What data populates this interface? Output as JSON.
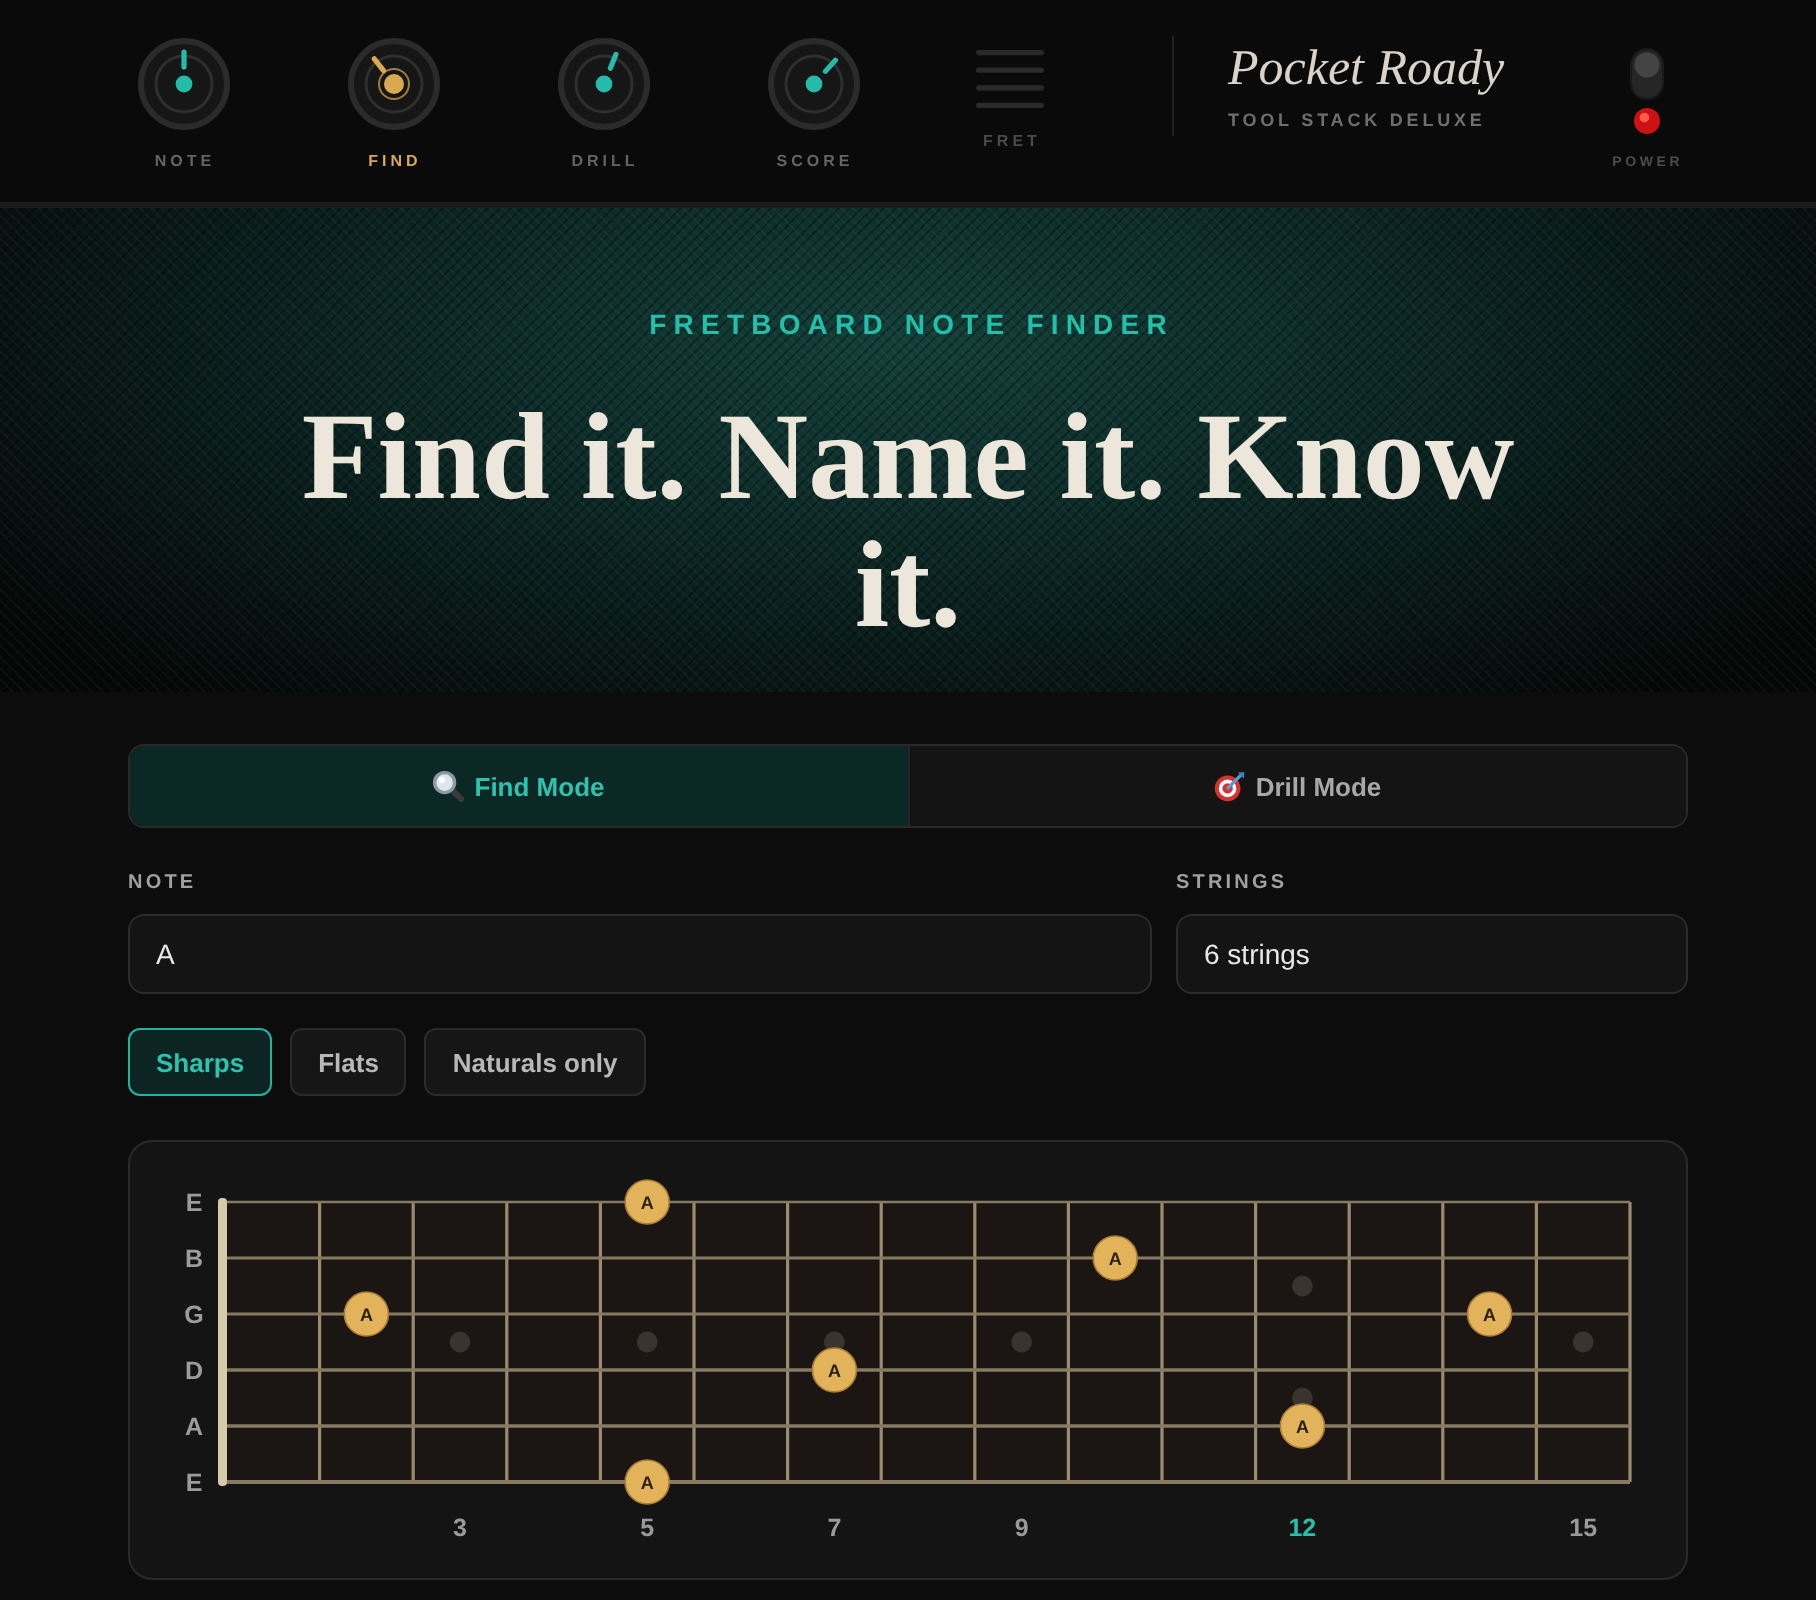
{
  "top_bar": {
    "nav": [
      {
        "kind": "knob",
        "label": "NOTE",
        "selected": false,
        "disabled": false
      },
      {
        "kind": "knob",
        "label": "FIND",
        "selected": true,
        "disabled": false
      },
      {
        "kind": "knob",
        "label": "DRILL",
        "selected": false,
        "disabled": false
      },
      {
        "kind": "knob",
        "label": "SCORE",
        "selected": false,
        "disabled": false
      },
      {
        "kind": "lines",
        "label": "FRET",
        "selected": false,
        "disabled": true
      }
    ],
    "brand": {
      "title": "Pocket Roady",
      "subtitle": "TOOL STACK DELUXE"
    },
    "power": {
      "label": "POWER",
      "on": true
    }
  },
  "hero": {
    "eyebrow": "FRETBOARD NOTE FINDER",
    "headline": "Find it. Name it. Know it."
  },
  "mode_tabs": [
    {
      "kind": "find",
      "label": "Find Mode",
      "selected": true
    },
    {
      "kind": "drill",
      "label": "Drill Mode",
      "selected": false
    }
  ],
  "fields": {
    "note": {
      "label": "NOTE",
      "value": "A"
    },
    "strings": {
      "label": "STRINGS",
      "value": "6 strings"
    }
  },
  "filters": [
    {
      "label": "Sharps",
      "selected": true
    },
    {
      "label": "Flats",
      "selected": false
    },
    {
      "label": "Naturals only",
      "selected": false
    }
  ],
  "fretboard": {
    "frets": [
      {
        "kind": "plain"
      },
      {
        "kind": "plain"
      },
      {
        "kind": "single",
        "label": "3",
        "highlighted": false
      },
      {
        "kind": "plain"
      },
      {
        "kind": "single",
        "label": "5",
        "highlighted": false
      },
      {
        "kind": "plain"
      },
      {
        "kind": "single",
        "label": "7",
        "highlighted": false
      },
      {
        "kind": "plain"
      },
      {
        "kind": "single",
        "label": "9",
        "highlighted": false
      },
      {
        "kind": "plain"
      },
      {
        "kind": "plain"
      },
      {
        "kind": "double",
        "label": "12",
        "highlighted": true
      },
      {
        "kind": "plain"
      },
      {
        "kind": "plain"
      },
      {
        "kind": "single",
        "label": "15",
        "highlighted": false
      }
    ],
    "strings": [
      {
        "label": "E",
        "cells": [
          {
            "kind": "empty"
          },
          {
            "kind": "empty"
          },
          {
            "kind": "empty"
          },
          {
            "kind": "empty"
          },
          {
            "kind": "note",
            "label": "A"
          },
          {
            "kind": "empty"
          },
          {
            "kind": "empty"
          },
          {
            "kind": "empty"
          },
          {
            "kind": "empty"
          },
          {
            "kind": "empty"
          },
          {
            "kind": "empty"
          },
          {
            "kind": "empty"
          },
          {
            "kind": "empty"
          },
          {
            "kind": "empty"
          },
          {
            "kind": "empty"
          }
        ]
      },
      {
        "label": "B",
        "cells": [
          {
            "kind": "empty"
          },
          {
            "kind": "empty"
          },
          {
            "kind": "empty"
          },
          {
            "kind": "empty"
          },
          {
            "kind": "empty"
          },
          {
            "kind": "empty"
          },
          {
            "kind": "empty"
          },
          {
            "kind": "empty"
          },
          {
            "kind": "empty"
          },
          {
            "kind": "note",
            "label": "A"
          },
          {
            "kind": "empty"
          },
          {
            "kind": "empty"
          },
          {
            "kind": "empty"
          },
          {
            "kind": "empty"
          },
          {
            "kind": "empty"
          }
        ]
      },
      {
        "label": "G",
        "cells": [
          {
            "kind": "empty"
          },
          {
            "kind": "note",
            "label": "A"
          },
          {
            "kind": "empty"
          },
          {
            "kind": "empty"
          },
          {
            "kind": "empty"
          },
          {
            "kind": "empty"
          },
          {
            "kind": "empty"
          },
          {
            "kind": "empty"
          },
          {
            "kind": "empty"
          },
          {
            "kind": "empty"
          },
          {
            "kind": "empty"
          },
          {
            "kind": "empty"
          },
          {
            "kind": "empty"
          },
          {
            "kind": "note",
            "label": "A"
          },
          {
            "kind": "empty"
          }
        ]
      },
      {
        "label": "D",
        "cells": [
          {
            "kind": "empty"
          },
          {
            "kind": "empty"
          },
          {
            "kind": "empty"
          },
          {
            "kind": "empty"
          },
          {
            "kind": "empty"
          },
          {
            "kind": "empty"
          },
          {
            "kind": "note",
            "label": "A"
          },
          {
            "kind": "empty"
          },
          {
            "kind": "empty"
          },
          {
            "kind": "empty"
          },
          {
            "kind": "empty"
          },
          {
            "kind": "empty"
          },
          {
            "kind": "empty"
          },
          {
            "kind": "empty"
          },
          {
            "kind": "empty"
          }
        ]
      },
      {
        "label": "A",
        "cells": [
          {
            "kind": "empty"
          },
          {
            "kind": "empty"
          },
          {
            "kind": "empty"
          },
          {
            "kind": "empty"
          },
          {
            "kind": "empty"
          },
          {
            "kind": "empty"
          },
          {
            "kind": "empty"
          },
          {
            "kind": "empty"
          },
          {
            "kind": "empty"
          },
          {
            "kind": "empty"
          },
          {
            "kind": "empty"
          },
          {
            "kind": "note",
            "label": "A"
          },
          {
            "kind": "empty"
          },
          {
            "kind": "empty"
          },
          {
            "kind": "empty"
          }
        ]
      },
      {
        "label": "E",
        "cells": [
          {
            "kind": "empty"
          },
          {
            "kind": "empty"
          },
          {
            "kind": "empty"
          },
          {
            "kind": "empty"
          },
          {
            "kind": "note",
            "label": "A"
          },
          {
            "kind": "empty"
          },
          {
            "kind": "empty"
          },
          {
            "kind": "empty"
          },
          {
            "kind": "empty"
          },
          {
            "kind": "empty"
          },
          {
            "kind": "empty"
          },
          {
            "kind": "empty"
          },
          {
            "kind": "empty"
          },
          {
            "kind": "empty"
          },
          {
            "kind": "empty"
          }
        ]
      }
    ]
  }
}
